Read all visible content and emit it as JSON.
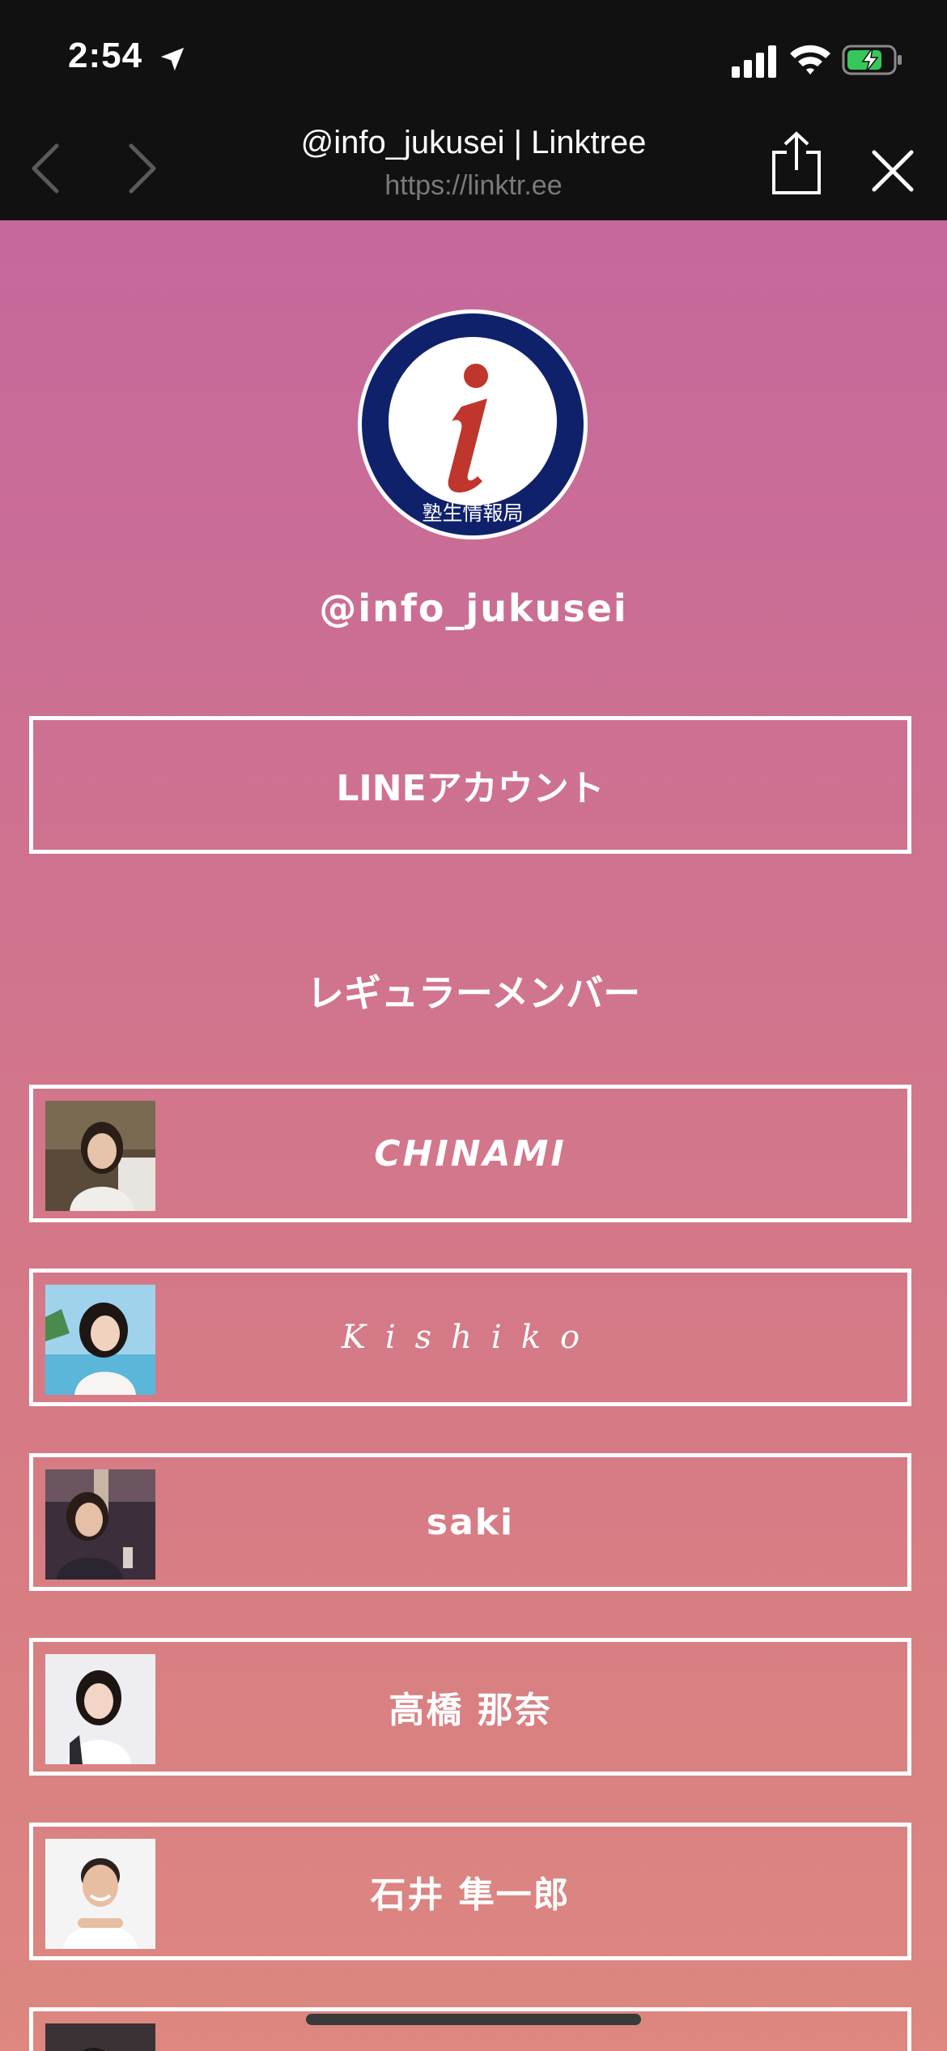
{
  "status_bar": {
    "time": "2:54",
    "icons": [
      "location-arrow-icon",
      "cellular-signal-icon",
      "wifi-icon",
      "battery-charging-icon"
    ]
  },
  "browser": {
    "title": "@info_jukusei | Linktree",
    "url": "https://linktr.ee",
    "icons": [
      "back-chevron-icon",
      "forward-chevron-icon",
      "share-icon",
      "close-icon"
    ]
  },
  "profile": {
    "handle": "@info_jukusei",
    "logo": {
      "letter": "i",
      "caption": "塾生情報局",
      "ring_color": "#10216b",
      "letter_color": "#c0362c"
    }
  },
  "links": {
    "line_account": "LINEアカウント"
  },
  "section": {
    "title": "レギュラーメンバー"
  },
  "members": [
    {
      "label": "CHINAMI",
      "style": "italic"
    },
    {
      "label": "Kishiko",
      "style": "script"
    },
    {
      "label": "saki",
      "style": "plain"
    },
    {
      "label": "高橋 那奈",
      "style": "plain"
    },
    {
      "label": "石井 隼一郎",
      "style": "plain"
    }
  ],
  "colors": {
    "background_top": "#c5689c",
    "background_bottom": "#dd8780",
    "chrome": "#111111",
    "button_border": "#ffffff"
  }
}
